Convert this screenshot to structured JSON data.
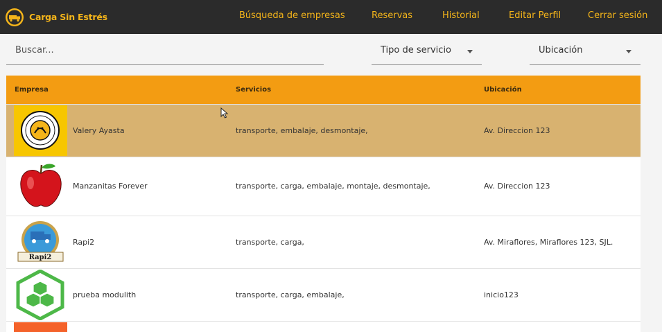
{
  "app": {
    "name": "Carga Sin Estrés"
  },
  "nav": [
    {
      "label": "Búsqueda de empresas"
    },
    {
      "label": "Reservas"
    },
    {
      "label": "Historial"
    },
    {
      "label": "Editar Perfil"
    },
    {
      "label": "Cerrar sesión"
    }
  ],
  "filters": {
    "search_placeholder": "Buscar...",
    "service_label": "Tipo de servicio",
    "location_label": "Ubicación"
  },
  "table": {
    "headers": {
      "company": "Empresa",
      "services": "Servicios",
      "location": "Ubicación"
    },
    "rows": [
      {
        "name": "Valery Ayasta",
        "services": "transporte, embalaje, desmontaje,",
        "location": "Av. Direccion 123",
        "logo_icon": "company-seal-logo-icon",
        "selected": true
      },
      {
        "name": "Manzanitas Forever",
        "services": "transporte, carga, embalaje, montaje, desmontaje,",
        "location": "Av. Direccion 123",
        "logo_icon": "apple-logo-icon",
        "selected": false
      },
      {
        "name": "Rapi2",
        "services": "transporte, carga,",
        "location": "Av. Miraflores, Miraflores 123, SJL.",
        "logo_icon": "truck-badge-logo-icon",
        "selected": false
      },
      {
        "name": "prueba modulith",
        "services": "transporte, carga, embalaje,",
        "location": "inicio123",
        "logo_icon": "hexagon-cubes-logo-icon",
        "selected": false
      }
    ]
  },
  "colors": {
    "topbar": "#2b2b2b",
    "accent": "#f5b51a",
    "header": "#f39c12",
    "selected_row": "#d8b270"
  }
}
